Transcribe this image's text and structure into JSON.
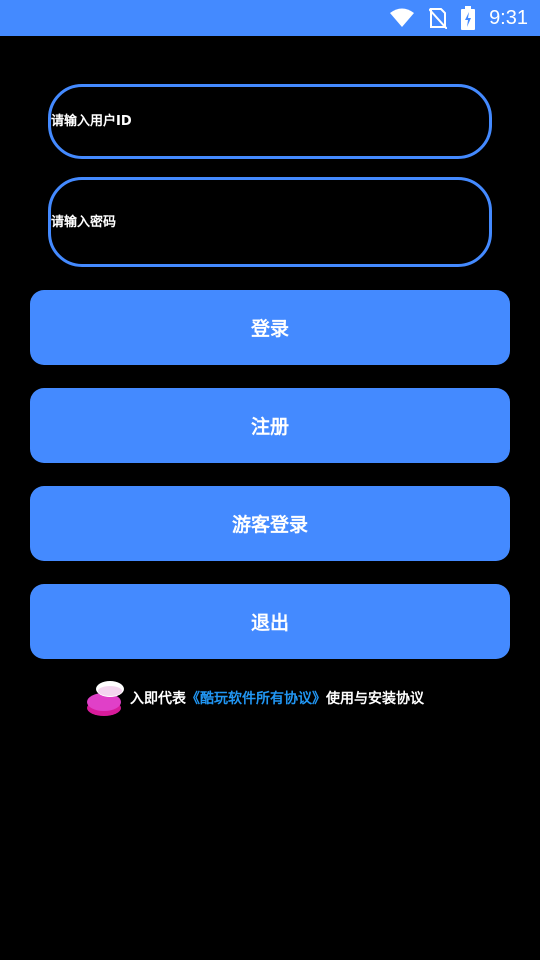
{
  "status_bar": {
    "time": "9:31",
    "icons": [
      "wifi-icon",
      "no-sim-icon",
      "battery-charging-icon"
    ]
  },
  "form": {
    "user_placeholder": "请输入用户ID",
    "password_placeholder": "请输入密码"
  },
  "buttons": {
    "login": "登录",
    "register": "注册",
    "guest_login": "游客登录",
    "exit": "退出"
  },
  "agreement": {
    "prefix": "入即代表",
    "link": "《酷玩软件所有协议》",
    "suffix": "使用与安装协议"
  },
  "colors": {
    "accent": "#448AFF",
    "link": "#2196F3",
    "background": "#000000"
  }
}
